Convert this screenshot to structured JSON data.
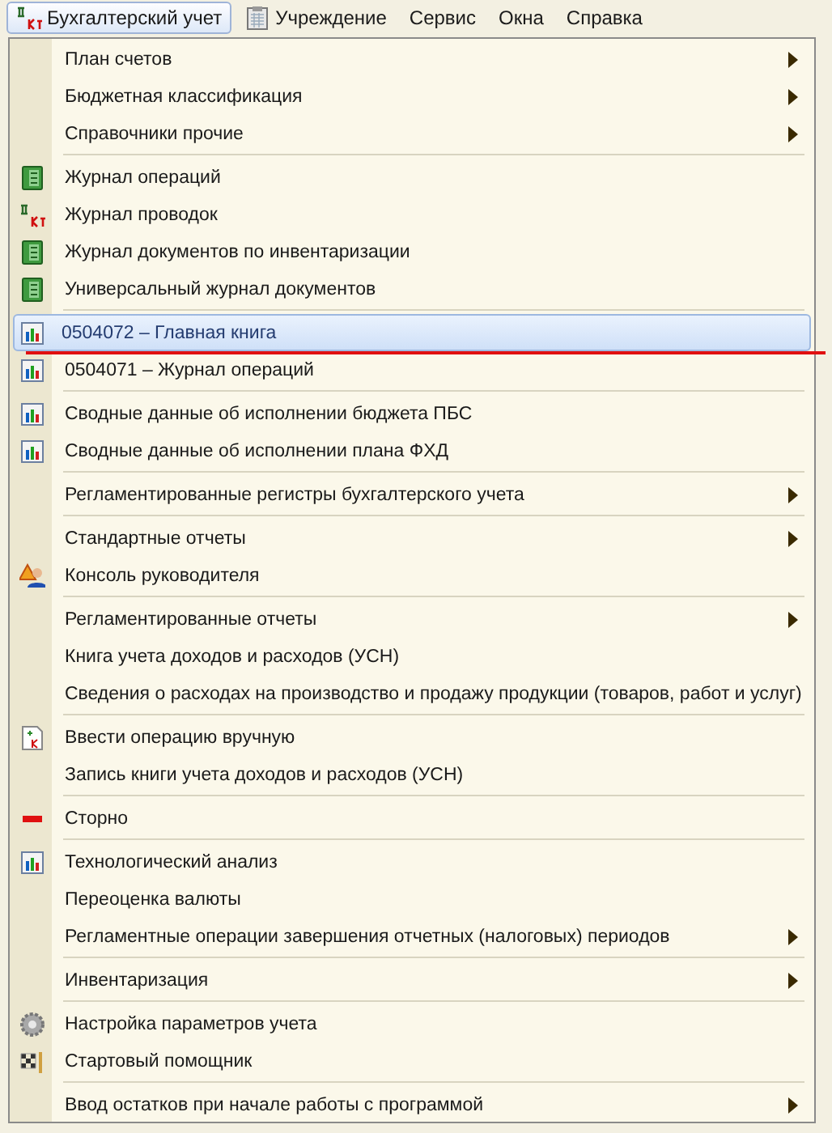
{
  "menubar": [
    {
      "label": "Бухгалтерский учет",
      "kind": "dtkt",
      "selected": true
    },
    {
      "label": "Учреждение",
      "kind": "clipboard",
      "selected": false
    },
    {
      "label": "Сервис",
      "selected": false
    },
    {
      "label": "Окна",
      "selected": false
    },
    {
      "label": "Справка",
      "selected": false
    }
  ],
  "menu": {
    "groups": [
      [
        {
          "label": "План счетов",
          "submenu": true,
          "selected": false
        },
        {
          "label": "Бюджетная классификация",
          "submenu": true,
          "selected": false
        },
        {
          "label": "Справочники прочие",
          "submenu": true,
          "selected": false
        }
      ],
      [
        {
          "label": "Журнал операций",
          "kind": "journal",
          "selected": false
        },
        {
          "label": "Журнал проводок",
          "kind": "dtkt",
          "selected": false
        },
        {
          "label": "Журнал документов по инвентаризации",
          "kind": "journal",
          "selected": false
        },
        {
          "label": "Универсальный журнал документов",
          "kind": "journal",
          "selected": false
        }
      ],
      [
        {
          "label": "0504072  –  Главная книга",
          "kind": "report",
          "selected": true,
          "underlined": true
        },
        {
          "label": "0504071  –  Журнал операций",
          "kind": "report",
          "selected": false
        }
      ],
      [
        {
          "label": "Сводные данные об исполнении бюджета ПБС",
          "kind": "report",
          "selected": false
        },
        {
          "label": "Сводные данные об исполнении плана ФХД",
          "kind": "report",
          "selected": false
        }
      ],
      [
        {
          "label": "Регламентированные регистры бухгалтерского учета",
          "submenu": true,
          "selected": false
        }
      ],
      [
        {
          "label": "Стандартные отчеты",
          "submenu": true,
          "selected": false
        },
        {
          "label": "Консоль руководителя",
          "kind": "console",
          "selected": false
        }
      ],
      [
        {
          "label": "Регламентированные отчеты",
          "submenu": true,
          "selected": false
        },
        {
          "label": "Книга учета доходов и расходов (УСН)",
          "selected": false
        },
        {
          "label": "Сведения о расходах на производство и продажу продукции (товаров, работ и услуг)",
          "selected": false
        }
      ],
      [
        {
          "label": "Ввести операцию вручную",
          "kind": "manual",
          "selected": false
        },
        {
          "label": "Запись книги учета доходов и расходов (УСН)",
          "selected": false
        }
      ],
      [
        {
          "label": "Сторно",
          "kind": "storno",
          "selected": false
        }
      ],
      [
        {
          "label": "Технологический анализ",
          "kind": "report",
          "selected": false
        },
        {
          "label": "Переоценка валюты",
          "selected": false
        },
        {
          "label": "Регламентные операции завершения отчетных (налоговых) периодов",
          "submenu": true,
          "selected": false
        }
      ],
      [
        {
          "label": "Инвентаризация",
          "submenu": true,
          "selected": false
        }
      ],
      [
        {
          "label": "Настройка параметров учета",
          "kind": "gear",
          "selected": false
        },
        {
          "label": "Стартовый помощник",
          "kind": "flag",
          "selected": false
        }
      ],
      [
        {
          "label": "Ввод остатков при начале работы с программой",
          "submenu": true,
          "selected": false
        }
      ]
    ]
  }
}
